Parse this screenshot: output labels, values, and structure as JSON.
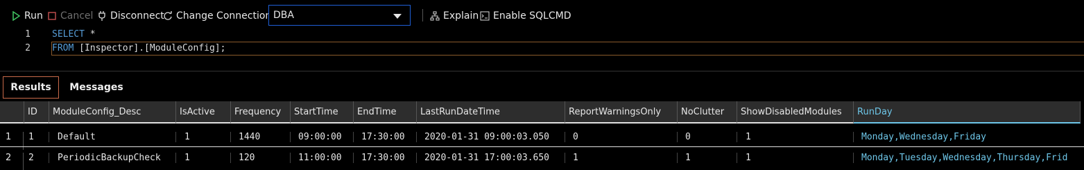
{
  "toolbar": {
    "run_label": "Run",
    "cancel_label": "Cancel",
    "disconnect_label": "Disconnect",
    "change_connection_label": "Change Connection",
    "database": "DBA",
    "explain_label": "Explain",
    "enable_sqlcmd_label": "Enable SQLCMD"
  },
  "editor": {
    "lines": [
      {
        "number": "1",
        "keyword": "SELECT",
        "rest": " *"
      },
      {
        "number": "2",
        "keyword": "FROM",
        "rest": " [Inspector].[ModuleConfig];"
      }
    ]
  },
  "tabs": {
    "results": "Results",
    "messages": "Messages"
  },
  "grid": {
    "columns": [
      "ID",
      "ModuleConfig_Desc",
      "IsActive",
      "Frequency",
      "StartTime",
      "EndTime",
      "LastRunDateTime",
      "ReportWarningsOnly",
      "NoClutter",
      "ShowDisabledModules",
      "RunDay"
    ],
    "rows": [
      {
        "num": "1",
        "cells": [
          "1",
          "Default",
          "1",
          "1440",
          "09:00:00",
          "17:30:00",
          "2020-01-31 09:00:03.050",
          "0",
          "0",
          "1",
          "Monday,Wednesday,Friday"
        ]
      },
      {
        "num": "2",
        "cells": [
          "2",
          "PeriodicBackupCheck",
          "1",
          "120",
          "11:00:00",
          "17:30:00",
          "2020-01-31 17:00:03.650",
          "1",
          "1",
          "1",
          "Monday,Tuesday,Wednesday,Thursday,Frid"
        ]
      }
    ]
  },
  "colors": {
    "accent": "#6ec6e8",
    "keyword": "#569cd6",
    "selection_border": "#1f5fd6"
  }
}
